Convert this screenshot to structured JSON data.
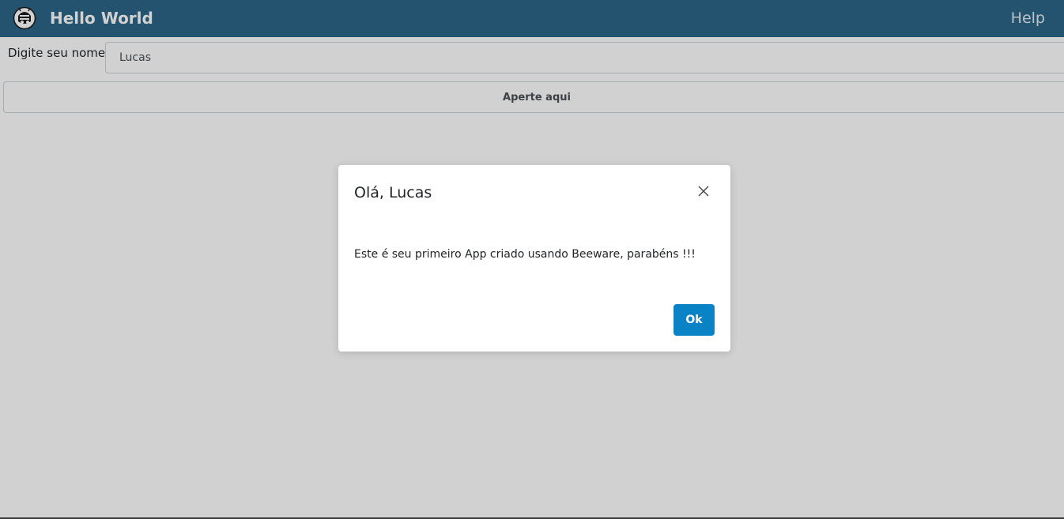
{
  "navbar": {
    "logo_icon": "bee-robot-logo-icon",
    "title": "Hello World",
    "help_label": "Help",
    "background_color": "#2b6688"
  },
  "form": {
    "name_label": "Digite seu nome:",
    "name_value": "Lucas",
    "button_label": "Aperte aqui"
  },
  "dialog": {
    "title": "Olá, Lucas",
    "message": "Este é seu primeiro App criado usando Beeware, parabéns !!!",
    "ok_label": "Ok",
    "close_icon": "close-icon",
    "ok_color": "#0a83c6"
  }
}
